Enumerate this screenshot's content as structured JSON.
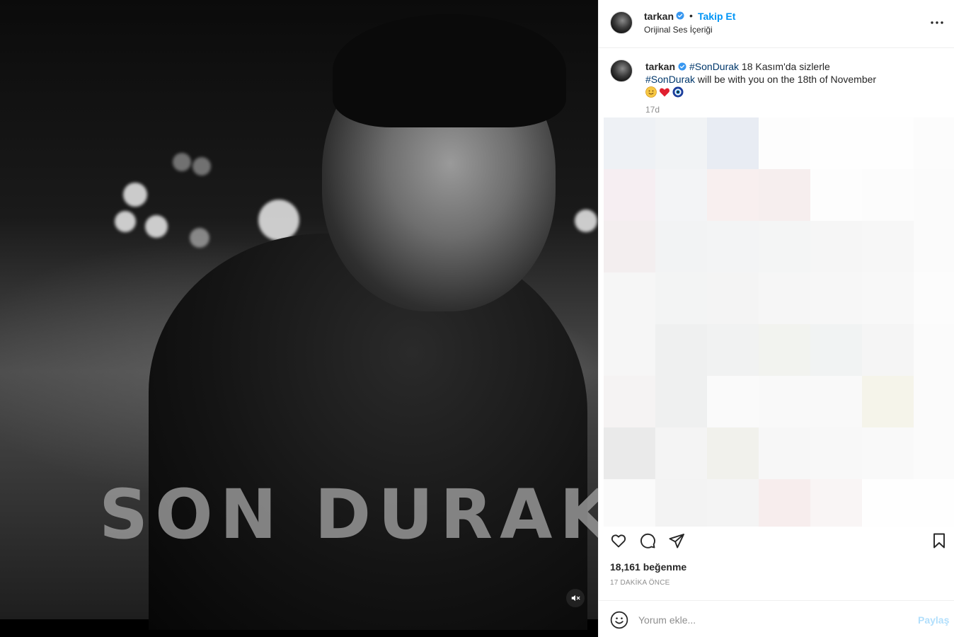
{
  "media": {
    "title_art": "SON DURAK",
    "mute_icon": "speaker-muted-icon"
  },
  "header": {
    "username": "tarkan",
    "verified": true,
    "separator": "•",
    "follow_label": "Takip Et",
    "audio_label": "Orijinal Ses İçeriği",
    "more_icon": "more-horizontal-icon"
  },
  "caption": {
    "username": "tarkan",
    "hashtag": "#SonDurak",
    "line1_text": " 18 Kasım'da sizlerle",
    "line2_text": " will be with you on the 18th of November",
    "emojis": [
      "smiling-face",
      "red-heart",
      "nazar-amulet"
    ],
    "time": "17d"
  },
  "actions": {
    "like_icon": "heart-icon",
    "comment_icon": "comment-icon",
    "share_icon": "send-icon",
    "save_icon": "bookmark-icon"
  },
  "likes": "18,161 beğenme",
  "posted_ago": "17 DAKİKA ÖNCE",
  "comment": {
    "placeholder": "Yorum ekle...",
    "value": "",
    "post_label": "Paylaş"
  },
  "colors": {
    "accent": "#0095f6",
    "hashtag": "#00376b",
    "muted_text": "#8e8e8e",
    "post_disabled": "#b2dffc"
  },
  "blurred_tiles": [
    "#eef1f5",
    "#f1f3f5",
    "#e8ecf3",
    "#fdfdfd",
    "#fefefe",
    "#fefefe",
    "#fcfcfc",
    "#f6eef2",
    "#f3f4f6",
    "#f8efef",
    "#f6eeee",
    "#fdfdfd",
    "#fcfcfc",
    "#fbfbfb",
    "#f3eeef",
    "#f2f3f4",
    "#f3f4f5",
    "#f4f5f5",
    "#f6f6f6",
    "#f7f7f7",
    "#fbfbfb",
    "#f6f6f6",
    "#f3f4f4",
    "#f4f4f4",
    "#f6f6f6",
    "#f7f7f7",
    "#f8f8f8",
    "#fcfcfc",
    "#f6f6f6",
    "#eff0f0",
    "#f1f2f2",
    "#f2f3ef",
    "#f1f3f3",
    "#f5f5f5",
    "#fbfbfb",
    "#f5f3f3",
    "#eff0f0",
    "#fafafa",
    "#f9f9f9",
    "#f9f9f9",
    "#f5f4ea",
    "#fbfbfb",
    "#eaeaea",
    "#f4f4f4",
    "#f1f1ec",
    "#f7f7f7",
    "#f8f8f8",
    "#f9f9f9",
    "#fbfbfb",
    "#fafafa",
    "#f3f3f3",
    "#f4f4f4",
    "#f7eded",
    "#f9f5f5",
    "#fefefe",
    "#fefefe"
  ]
}
